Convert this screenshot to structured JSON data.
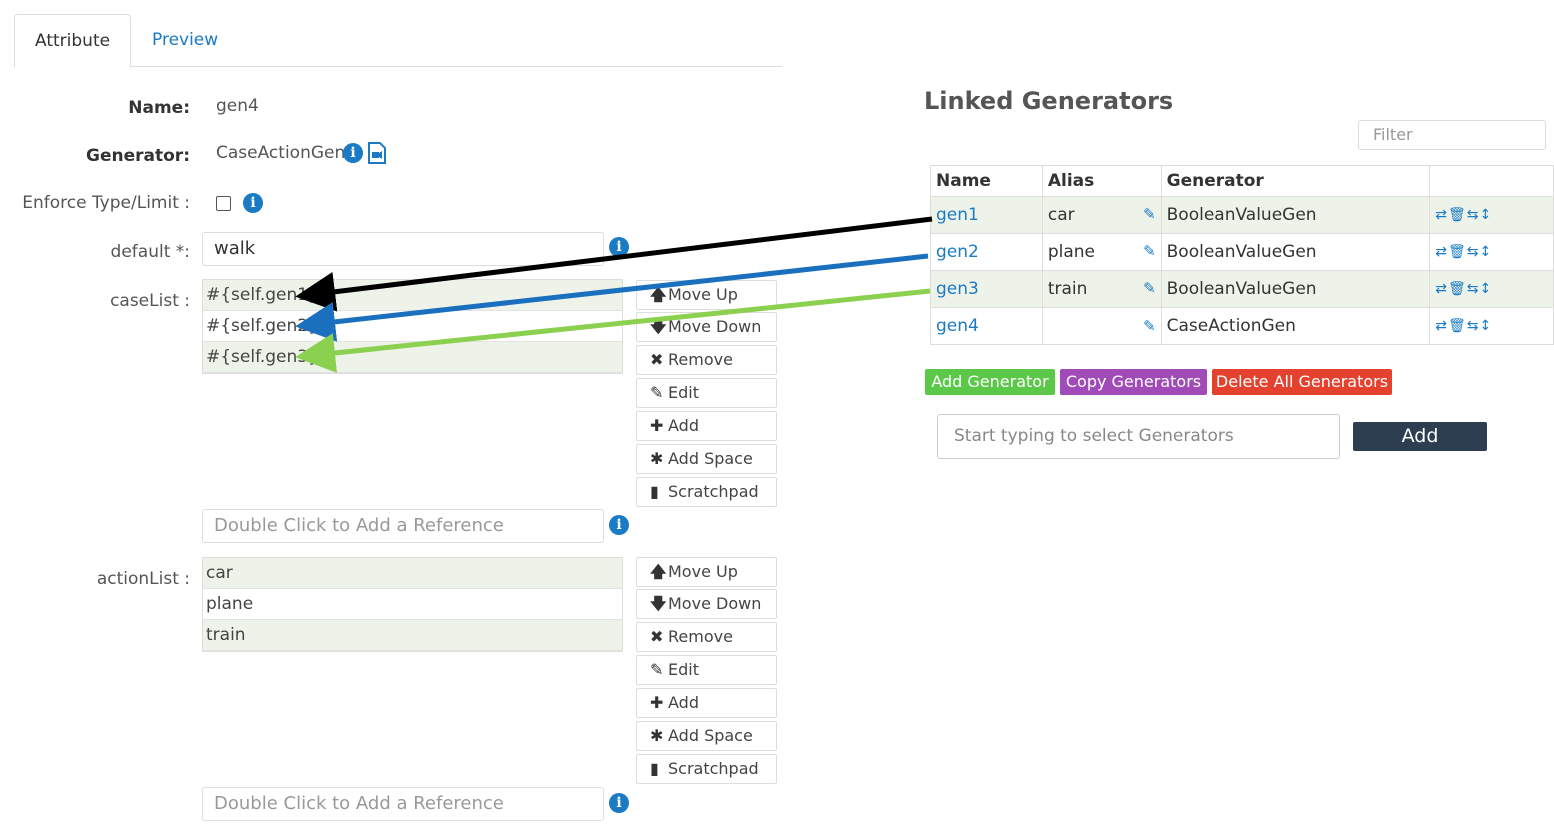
{
  "tabs": {
    "attribute": "Attribute",
    "preview": "Preview"
  },
  "form": {
    "name_label": "Name:",
    "name_value": "gen4",
    "generator_label": "Generator:",
    "generator_value": "CaseActionGen",
    "enforce_label": "Enforce Type/Limit :",
    "default_label": "default *:",
    "default_value": "walk",
    "caselist_label": "caseList :",
    "caselist_items": [
      "#{self.gen1}",
      "#{self.gen2}",
      "#{self.gen3}"
    ],
    "actionlist_label": "actionList :",
    "actionlist_items": [
      "car",
      "plane",
      "train"
    ],
    "reference_placeholder": "Double Click to Add a Reference"
  },
  "list_buttons": {
    "move_up": "Move Up",
    "move_down": "Move Down",
    "remove": "Remove",
    "edit": "Edit",
    "add": "Add",
    "add_space": "Add Space",
    "scratchpad": "Scratchpad"
  },
  "linked": {
    "title": "Linked Generators",
    "filter_placeholder": "Filter",
    "headers": {
      "name": "Name",
      "alias": "Alias",
      "generator": "Generator"
    },
    "rows": [
      {
        "name": "gen1",
        "alias": "car",
        "generator": "BooleanValueGen"
      },
      {
        "name": "gen2",
        "alias": "plane",
        "generator": "BooleanValueGen"
      },
      {
        "name": "gen3",
        "alias": "train",
        "generator": "BooleanValueGen"
      },
      {
        "name": "gen4",
        "alias": "",
        "generator": "CaseActionGen"
      }
    ],
    "add_generator": "Add Generator",
    "copy_generators": "Copy Generators",
    "delete_all": "Delete All Generators",
    "typeahead_placeholder": "Start typing to select Generators",
    "add_button": "Add"
  },
  "colors": {
    "accent": "#1a7bc4",
    "arrow_gen1": "#000000",
    "arrow_gen2": "#1a6fbf",
    "arrow_gen3": "#8bd04f"
  }
}
